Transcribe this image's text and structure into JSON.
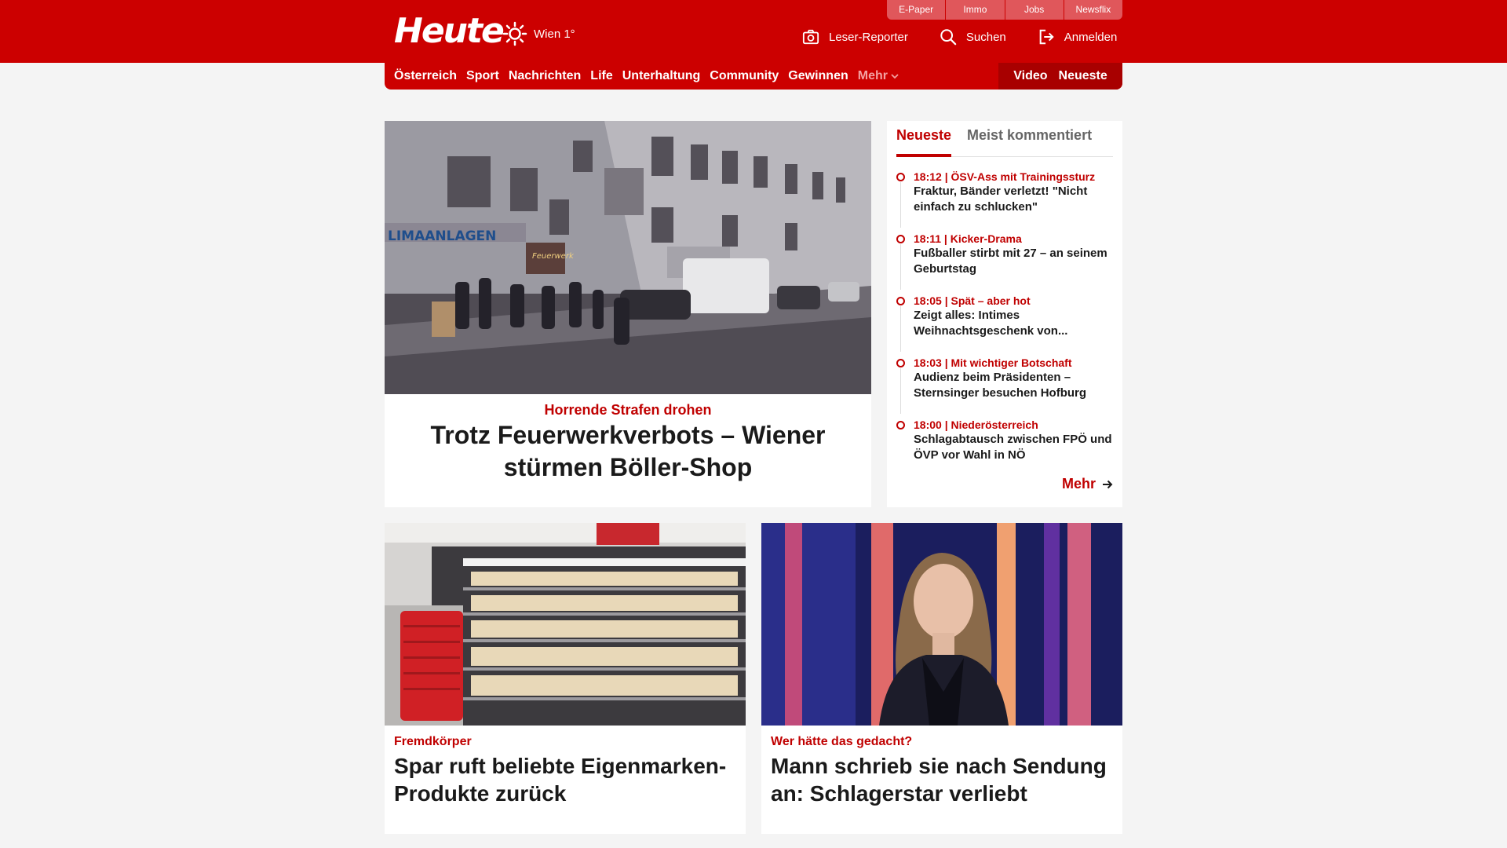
{
  "header": {
    "logo": "Heute",
    "weather": "Wien 1°",
    "top_links": [
      "E-Paper",
      "Immo",
      "Jobs",
      "Newsflix"
    ],
    "actions": {
      "reporter": "Leser-Reporter",
      "search": "Suchen",
      "login": "Anmelden"
    },
    "icons": {
      "weather": "sun-icon",
      "reporter": "camera-icon",
      "search": "search-icon",
      "login": "login-icon"
    }
  },
  "nav": {
    "items": [
      "Österreich",
      "Sport",
      "Nachrichten",
      "Life",
      "Unterhaltung",
      "Community",
      "Gewinnen"
    ],
    "more": "Mehr",
    "right": [
      "Video",
      "Neueste"
    ]
  },
  "hero": {
    "kicker": "Horrende Strafen drohen",
    "title": "Trotz Feuerwerkverbots – Wiener stürmen Böller-Shop",
    "image": {
      "sign_text": "LIMAANLAGEN",
      "shop_sign": "Feuerwerk"
    }
  },
  "sidebar": {
    "tabs": [
      "Neueste",
      "Meist kommentiert"
    ],
    "active_tab": "Neueste",
    "items": [
      {
        "meta": "18:12 | ÖSV-Ass mit Trainingssturz",
        "title": "Fraktur, Bänder verletzt! \"Nicht einfach zu schlucken\""
      },
      {
        "meta": "18:11 | Kicker-Drama",
        "title": "Fußballer stirbt mit 27 – an seinem Geburtstag"
      },
      {
        "meta": "18:05 | Spät – aber hot",
        "title": "Zeigt alles: Intimes Weihnachtsgeschenk von..."
      },
      {
        "meta": "18:03 | Mit wichtiger Botschaft",
        "title": "Audienz beim Präsidenten – Sternsinger besuchen Hofburg"
      },
      {
        "meta": "18:00 | Niederösterreich",
        "title": "Schlagabtausch zwischen FPÖ und ÖVP vor Wahl in NÖ"
      }
    ],
    "more": "Mehr"
  },
  "cards": [
    {
      "kicker": "Fremdkörper",
      "title": "Spar ruft beliebte Eigenmarken-Produkte zurück"
    },
    {
      "kicker": "Wer hätte das gedacht?",
      "title": "Mann schrieb sie nach Sendung an: Schlagerstar verliebt"
    }
  ],
  "colors": {
    "brand_red": "#cc0000",
    "dark_red": "#a80000",
    "kicker_red": "#c00000",
    "background": "#f4f4f4"
  }
}
